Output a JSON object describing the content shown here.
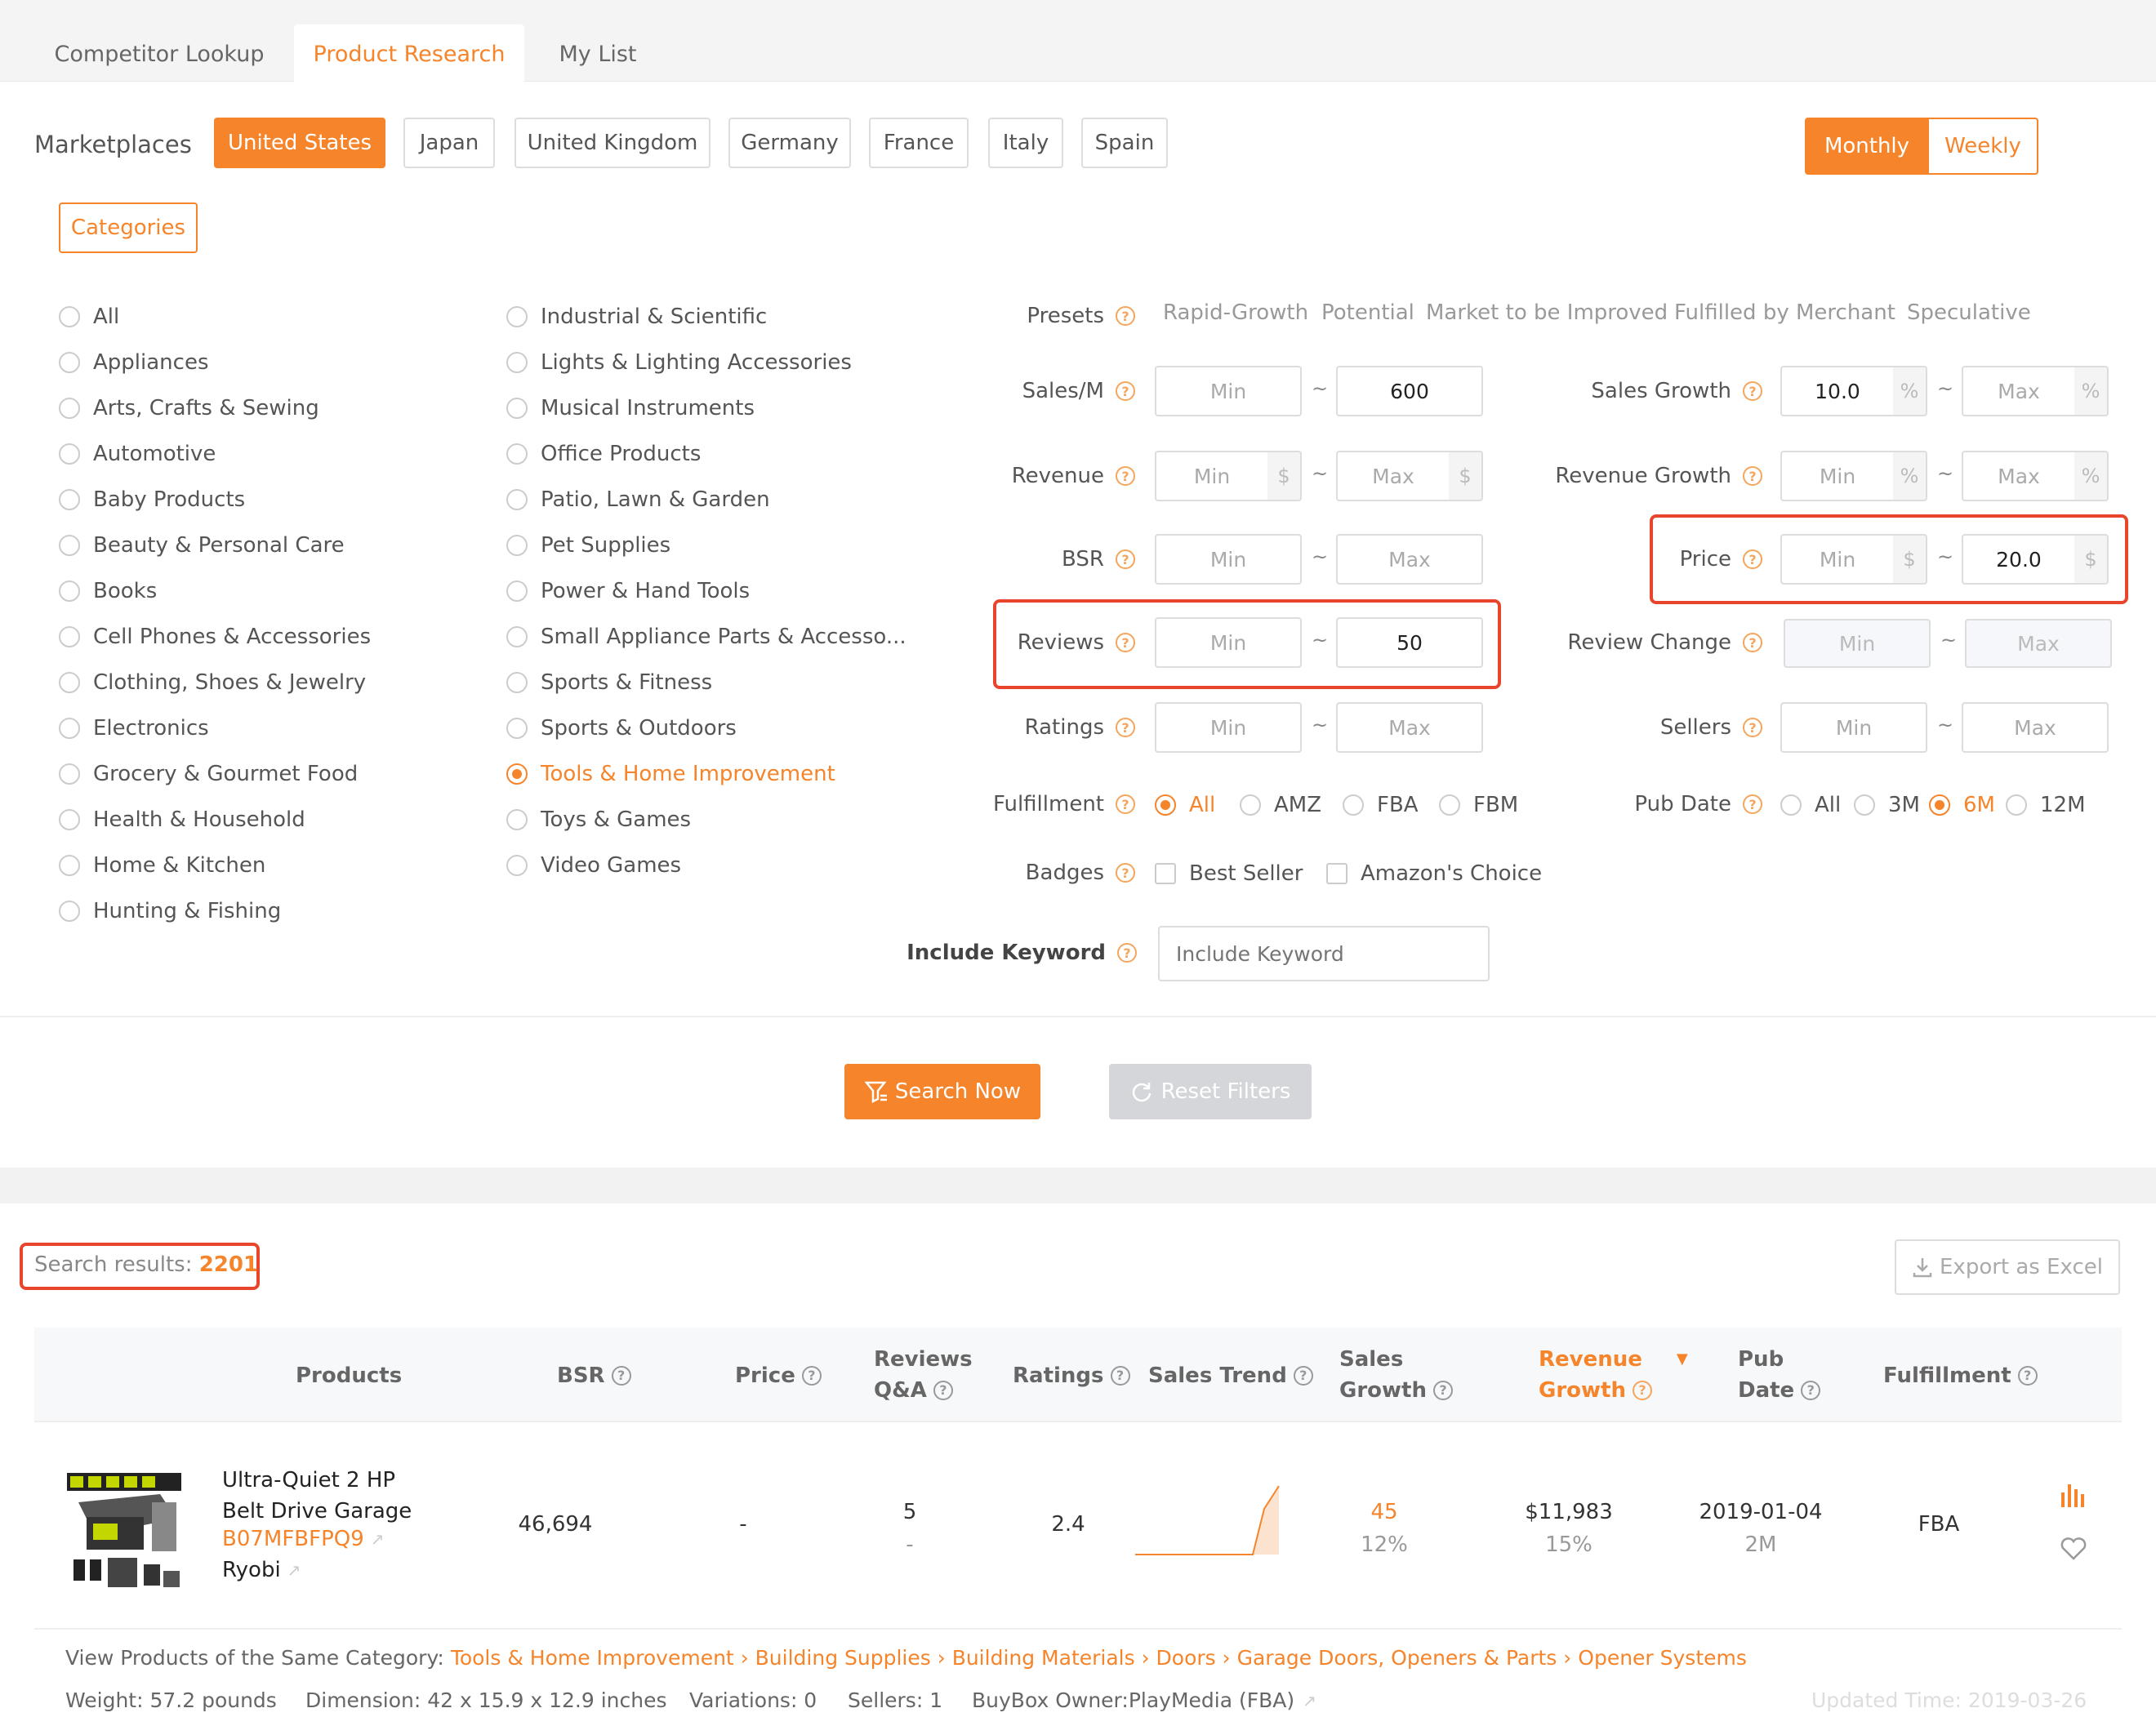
{
  "tabs": [
    "Competitor Lookup",
    "Product Research",
    "My List"
  ],
  "marketplaces": {
    "label": "Marketplaces",
    "items": [
      "United States",
      "Japan",
      "United Kingdom",
      "Germany",
      "France",
      "Italy",
      "Spain"
    ],
    "selected": "United States"
  },
  "period": {
    "monthly": "Monthly",
    "weekly": "Weekly",
    "selected": "Monthly"
  },
  "categories_button": "Categories",
  "categories_col1": [
    "All",
    "Appliances",
    "Arts, Crafts & Sewing",
    "Automotive",
    "Baby Products",
    "Beauty & Personal Care",
    "Books",
    "Cell Phones & Accessories",
    "Clothing, Shoes & Jewelry",
    "Electronics",
    "Grocery & Gourmet Food",
    "Health & Household",
    "Home & Kitchen",
    "Hunting & Fishing"
  ],
  "categories_col2": [
    "Industrial & Scientific",
    "Lights & Lighting Accessories",
    "Musical Instruments",
    "Office Products",
    "Patio, Lawn & Garden",
    "Pet Supplies",
    "Power & Hand Tools",
    "Small Appliance Parts & Accesso...",
    "Sports & Fitness",
    "Sports & Outdoors",
    "Tools & Home Improvement",
    "Toys & Games",
    "Video Games"
  ],
  "selected_category": "Tools & Home Improvement",
  "filters": {
    "presets_label": "Presets",
    "presets": [
      "Rapid-Growth",
      "Potential",
      "Market to be Improved",
      "Fulfilled by Merchant",
      "Speculative"
    ],
    "sales": {
      "label": "Sales/M",
      "min": "Min",
      "max": "600"
    },
    "sales_growth": {
      "label": "Sales Growth",
      "min": "10.0",
      "max": "Max",
      "unit": "%"
    },
    "revenue": {
      "label": "Revenue",
      "min": "Min",
      "max": "Max",
      "unit": "$"
    },
    "revenue_growth": {
      "label": "Revenue Growth",
      "min": "Min",
      "max": "Max",
      "unit": "%"
    },
    "bsr": {
      "label": "BSR",
      "min": "Min",
      "max": "Max"
    },
    "price": {
      "label": "Price",
      "min": "Min",
      "max": "20.0",
      "unit": "$"
    },
    "reviews": {
      "label": "Reviews",
      "min": "Min",
      "max": "50"
    },
    "review_change": {
      "label": "Review Change",
      "min": "Min",
      "max": "Max"
    },
    "ratings": {
      "label": "Ratings",
      "min": "Min",
      "max": "Max"
    },
    "sellers": {
      "label": "Sellers",
      "min": "Min",
      "max": "Max"
    },
    "tilde": "~",
    "fulfillment": {
      "label": "Fulfillment",
      "options": [
        "All",
        "AMZ",
        "FBA",
        "FBM"
      ],
      "selected": "All"
    },
    "pub_date": {
      "label": "Pub Date",
      "options": [
        "All",
        "3M",
        "6M",
        "12M"
      ],
      "selected": "6M"
    },
    "badges": {
      "label": "Badges",
      "options": [
        "Best Seller",
        "Amazon's Choice"
      ]
    },
    "keyword": {
      "label": "Include Keyword",
      "placeholder": "Include Keyword"
    }
  },
  "actions": {
    "search": "Search Now",
    "reset": "Reset Filters"
  },
  "results": {
    "label": "Search results: ",
    "count": "2201",
    "export": "Export as Excel"
  },
  "table": {
    "headers": {
      "products": "Products",
      "bsr": "BSR",
      "price": "Price",
      "reviews": "Reviews",
      "qa": "Q&A",
      "ratings": "Ratings",
      "sales_trend": "Sales Trend",
      "sales": "Sales",
      "growth": "Growth",
      "revenue": "Revenue",
      "revenue_growth": "Growth",
      "pub": "Pub",
      "date": "Date",
      "fulfillment": "Fulfillment"
    },
    "row": {
      "title_line1": "Ultra-Quiet 2 HP",
      "title_line2": "Belt Drive Garage",
      "asin": "B07MFBFPQ9",
      "brand": "Ryobi",
      "bsr": "46,694",
      "price": "-",
      "reviews": "5",
      "qa": "-",
      "ratings": "2.4",
      "sales": "45",
      "sales_growth": "12%",
      "revenue": "$11,983",
      "revenue_growth": "15%",
      "pub_date": "2019-01-04",
      "pub_age": "2M",
      "fulfillment": "FBA"
    }
  },
  "footer": {
    "view_label": "View Products of the Same Category: ",
    "crumbs": [
      "Tools & Home Improvement",
      "Building Supplies",
      "Building Materials",
      "Doors",
      "Garage Doors, Openers & Parts",
      "Opener Systems"
    ],
    "sep": " › ",
    "weight": "Weight: 57.2 pounds",
    "dimension": "Dimension: 42 x 15.9 x 12.9 inches",
    "variations": "Variations: 0",
    "sellers": "Sellers: 1",
    "buybox_label": "BuyBox Owner: ",
    "buybox": "PlayMedia (FBA)",
    "updated": "Updated Time: 2019-03-26"
  },
  "colors": {
    "accent": "#f5842b",
    "highlight": "#e8452c"
  }
}
